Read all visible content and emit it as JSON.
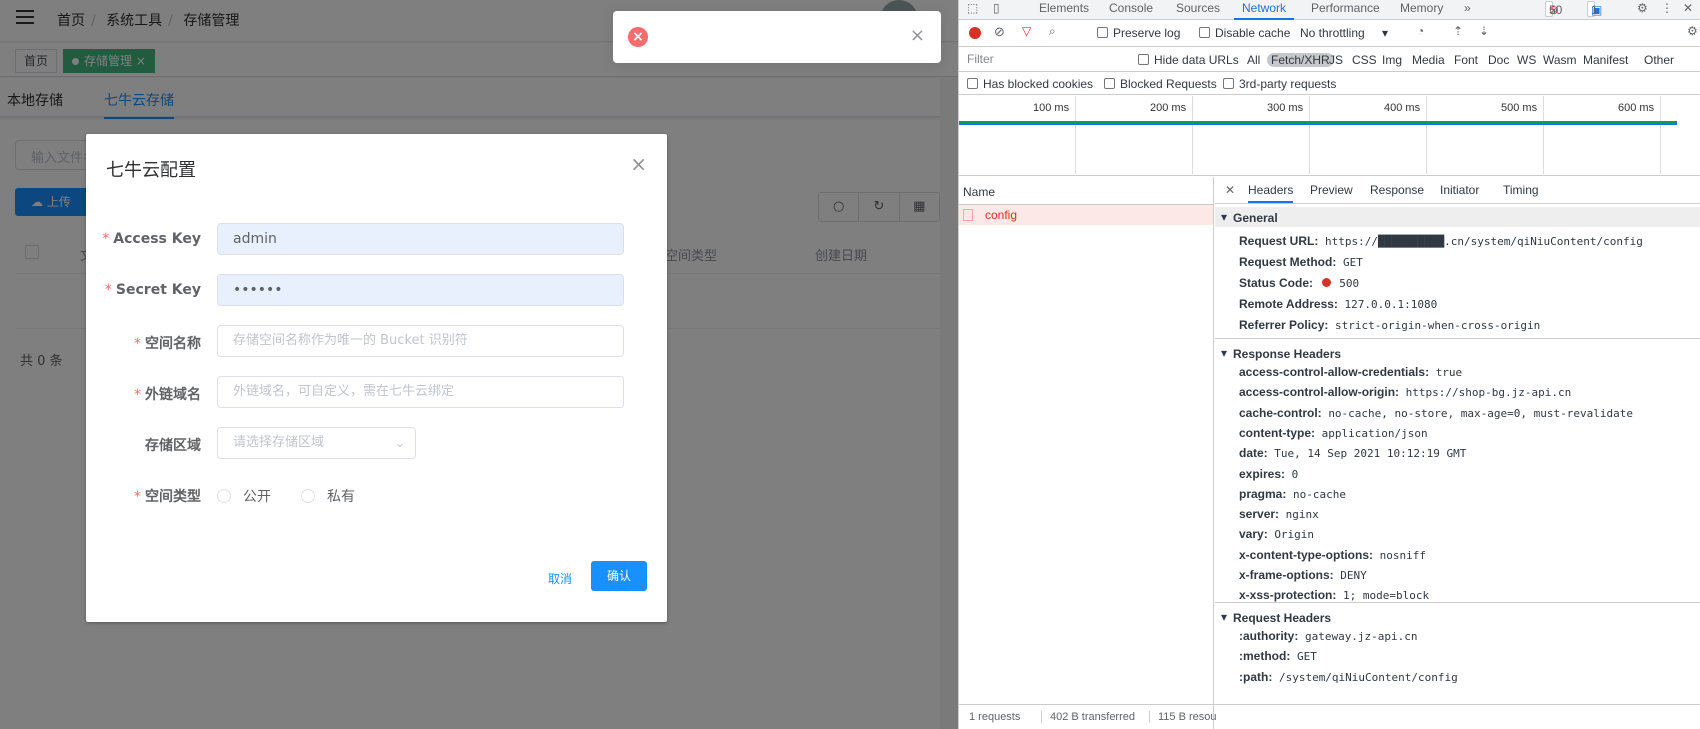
{
  "app": {
    "breadcrumbs": [
      "首页",
      "系统工具",
      "存储管理"
    ],
    "tags": [
      "首页",
      "存储管理"
    ],
    "tag_close": "×",
    "page_tabs": [
      "本地存储",
      "七牛云存储"
    ],
    "file_input_placeholder": "输入文件名",
    "upload_label": "上传",
    "table_headers": [
      "文",
      "空间类型",
      "创建日期"
    ],
    "total_text": "共 0 条"
  },
  "message": {
    "icon": "error-icon",
    "close": "×"
  },
  "dialog": {
    "title": "七牛云配置",
    "close": "×",
    "fields": [
      {
        "label": "Access Key",
        "required": true,
        "value": "admin",
        "placeholder": ""
      },
      {
        "label": "Secret Key",
        "required": true,
        "value": "••••••",
        "placeholder": ""
      },
      {
        "label": "空间名称",
        "required": true,
        "value": "",
        "placeholder": "存储空间名称作为唯一的 Bucket 识别符"
      },
      {
        "label": "外链域名",
        "required": true,
        "value": "",
        "placeholder": "外链域名，可自定义，需在七牛云绑定"
      },
      {
        "label": "存储区域",
        "required": false,
        "value": "",
        "placeholder": "请选择存储区域"
      },
      {
        "label": "空间类型",
        "required": true,
        "value": "",
        "placeholder": ""
      }
    ],
    "radio_options": [
      "公开",
      "私有"
    ],
    "cancel_label": "取消",
    "confirm_label": "确认"
  },
  "devtools": {
    "tabs": [
      "Elements",
      "Console",
      "Sources",
      "Network",
      "Performance",
      "Memory"
    ],
    "active_tab": "Network",
    "error_count": "50",
    "message_count": "1",
    "toolbar": {
      "preserve_log": "Preserve log",
      "disable_cache": "Disable cache",
      "throttling": "No throttling"
    },
    "filter_placeholder": "Filter",
    "hide_data_urls": "Hide data URLs",
    "filter_types": [
      "All",
      "Fetch/XHR",
      "JS",
      "CSS",
      "Img",
      "Media",
      "Font",
      "Doc",
      "WS",
      "Wasm",
      "Manifest",
      "Other"
    ],
    "active_filter": "Fetch/XHR",
    "checkboxes": [
      "Has blocked cookies",
      "Blocked Requests",
      "3rd-party requests"
    ],
    "timeline_ticks": [
      "100 ms",
      "200 ms",
      "300 ms",
      "400 ms",
      "500 ms",
      "600 ms"
    ],
    "name_header": "Name",
    "request_name": "config",
    "detail_tabs": [
      "Headers",
      "Preview",
      "Response",
      "Initiator",
      "Timing"
    ],
    "general_title": "General",
    "general": [
      {
        "k": "Request URL:",
        "v": "https://██████████.cn/system/qiNiuContent/config"
      },
      {
        "k": "Request Method:",
        "v": "GET"
      },
      {
        "k": "Status Code:",
        "v": "500"
      },
      {
        "k": "Remote Address:",
        "v": "127.0.0.1:1080"
      },
      {
        "k": "Referrer Policy:",
        "v": "strict-origin-when-cross-origin"
      }
    ],
    "response_title": "Response Headers",
    "response_headers": [
      {
        "k": "access-control-allow-credentials:",
        "v": "true"
      },
      {
        "k": "access-control-allow-origin:",
        "v": "https://shop-bg.jz-api.cn"
      },
      {
        "k": "cache-control:",
        "v": "no-cache, no-store, max-age=0, must-revalidate"
      },
      {
        "k": "content-type:",
        "v": "application/json"
      },
      {
        "k": "date:",
        "v": "Tue, 14 Sep 2021 10:12:19 GMT"
      },
      {
        "k": "expires:",
        "v": "0"
      },
      {
        "k": "pragma:",
        "v": "no-cache"
      },
      {
        "k": "server:",
        "v": "nginx"
      },
      {
        "k": "vary:",
        "v": "Origin"
      },
      {
        "k": "x-content-type-options:",
        "v": "nosniff"
      },
      {
        "k": "x-frame-options:",
        "v": "DENY"
      },
      {
        "k": "x-xss-protection:",
        "v": "1; mode=block"
      }
    ],
    "request_title": "Request Headers",
    "request_headers": [
      {
        "k": ":authority:",
        "v": "gateway.jz-api.cn"
      },
      {
        "k": ":method:",
        "v": "GET"
      },
      {
        "k": ":path:",
        "v": "/system/qiNiuContent/config"
      }
    ],
    "status_bar": [
      "1 requests",
      "402 B transferred",
      "115 B resou"
    ]
  }
}
